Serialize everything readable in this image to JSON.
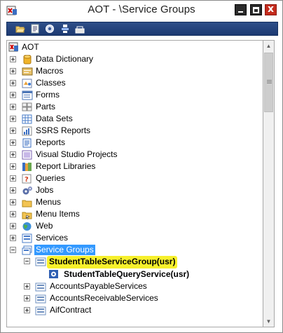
{
  "window": {
    "title": "AOT - \\Service Groups",
    "min_glyph": "",
    "max_glyph": "",
    "close_glyph": "x"
  },
  "toolbar": {
    "icons": [
      "open-icon",
      "properties-icon",
      "compile-icon",
      "import-icon",
      "export-icon"
    ]
  },
  "tree": {
    "root": "AOT",
    "items": [
      {
        "label": "Data Dictionary",
        "icon": "data-dictionary-icon"
      },
      {
        "label": "Macros",
        "icon": "macros-icon"
      },
      {
        "label": "Classes",
        "icon": "classes-icon"
      },
      {
        "label": "Forms",
        "icon": "forms-icon"
      },
      {
        "label": "Parts",
        "icon": "parts-icon"
      },
      {
        "label": "Data Sets",
        "icon": "data-sets-icon"
      },
      {
        "label": "SSRS Reports",
        "icon": "ssrs-reports-icon"
      },
      {
        "label": "Reports",
        "icon": "reports-icon"
      },
      {
        "label": "Visual Studio Projects",
        "icon": "visual-studio-projects-icon"
      },
      {
        "label": "Report Libraries",
        "icon": "report-libraries-icon"
      },
      {
        "label": "Queries",
        "icon": "queries-icon"
      },
      {
        "label": "Jobs",
        "icon": "jobs-icon"
      },
      {
        "label": "Menus",
        "icon": "menus-icon"
      },
      {
        "label": "Menu Items",
        "icon": "menu-items-icon"
      },
      {
        "label": "Web",
        "icon": "web-icon"
      },
      {
        "label": "Services",
        "icon": "services-icon"
      },
      {
        "label": "Service Groups",
        "icon": "service-groups-icon"
      }
    ],
    "service_group_child": "StudentTableServiceGroup(usr)",
    "service_child": "StudentTableQueryService(usr)",
    "sibling_groups": [
      "AccountsPayableServices",
      "AccountsReceivableServices",
      "AifContract"
    ]
  },
  "colors": {
    "selection": "#3399ff",
    "highlight": "#f7f02c",
    "toolbar": "#2f4f89"
  }
}
